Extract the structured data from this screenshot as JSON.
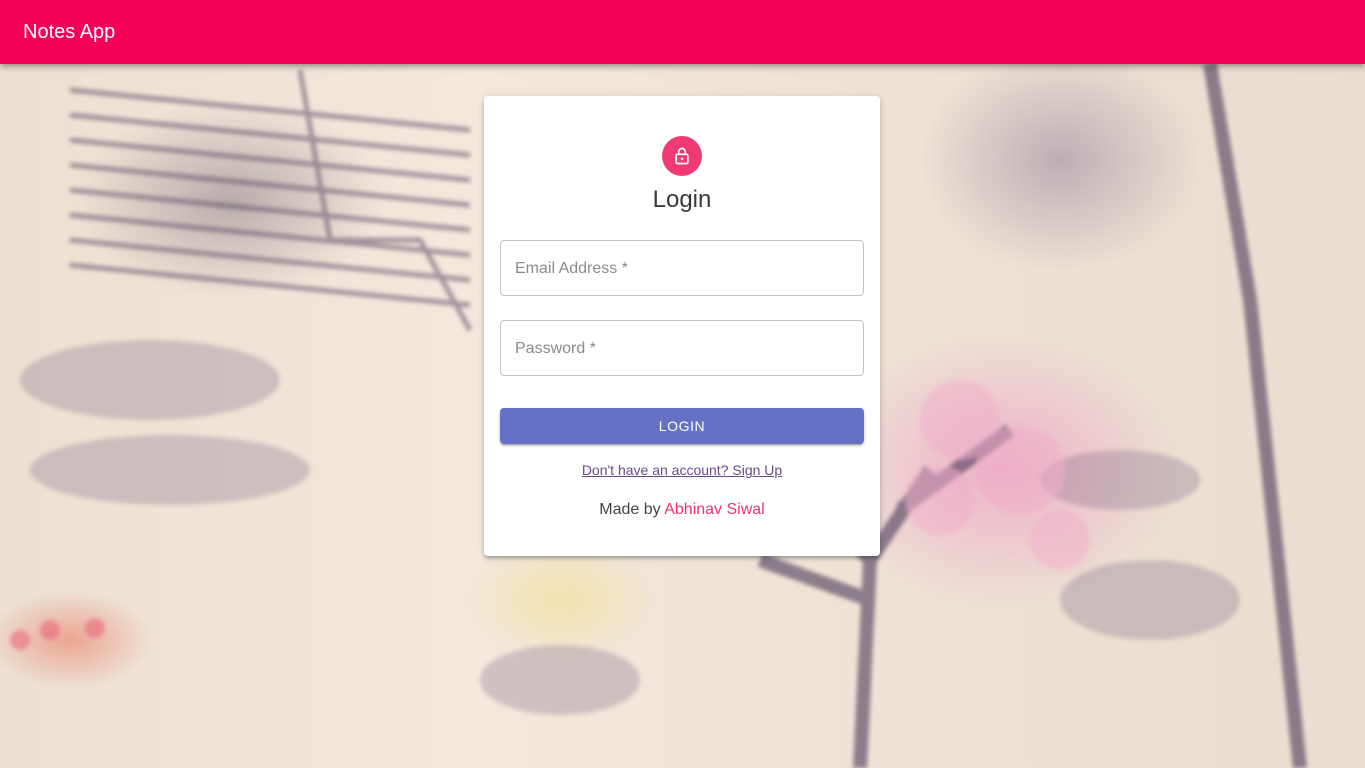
{
  "appbar": {
    "title": "Notes App"
  },
  "login_card": {
    "title": "Login",
    "icon": "lock-icon",
    "email": {
      "label": "Email Address *",
      "value": ""
    },
    "password": {
      "label": "Password *",
      "value": ""
    },
    "login_button": "LOGIN",
    "signup_link": "Don't have an account? Sign Up",
    "footer": {
      "prefix": "Made by ",
      "author": "Abhinav Siwal"
    }
  },
  "colors": {
    "appbar": "#f50057",
    "avatar": "#f03a74",
    "button": "#6571c4",
    "author_link": "#e9366f"
  }
}
